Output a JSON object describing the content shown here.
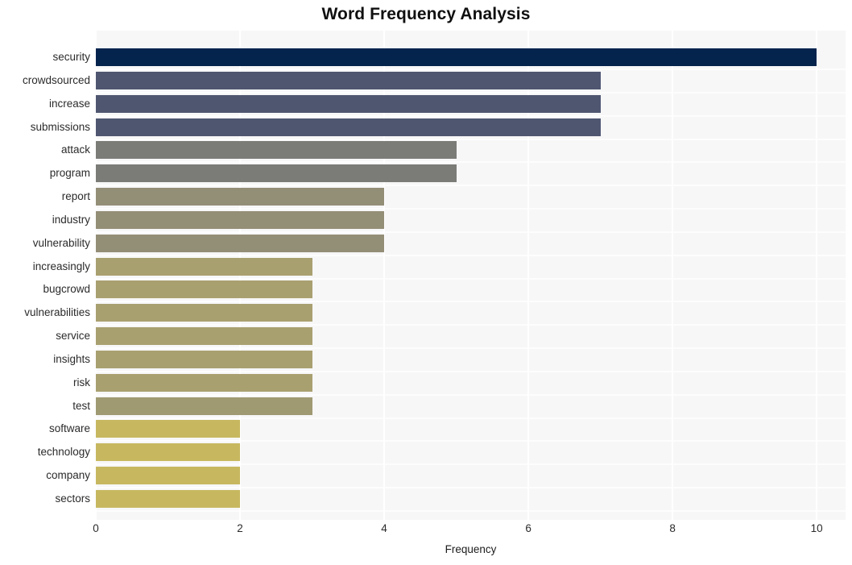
{
  "chart_data": {
    "type": "bar",
    "orientation": "horizontal",
    "title": "Word Frequency Analysis",
    "xlabel": "Frequency",
    "ylabel": "",
    "xlim": [
      0,
      10.4
    ],
    "xticks": [
      0,
      2,
      4,
      6,
      8,
      10
    ],
    "xtick_labels": [
      "0",
      "2",
      "4",
      "6",
      "8",
      "10"
    ],
    "grid": true,
    "legend": "none",
    "plot_background": "#f7f7f8",
    "figure_background": "#ffffff",
    "categories": [
      "security",
      "crowdsourced",
      "increase",
      "submissions",
      "attack",
      "program",
      "report",
      "industry",
      "vulnerability",
      "increasingly",
      "bugcrowd",
      "vulnerabilities",
      "service",
      "insights",
      "risk",
      "test",
      "software",
      "technology",
      "company",
      "sectors"
    ],
    "values": [
      10,
      7,
      7,
      7,
      5,
      5,
      4,
      4,
      4,
      3,
      3,
      3,
      3,
      3,
      3,
      3,
      2,
      2,
      2,
      2
    ],
    "bar_colors": [
      "#04234d",
      "#4e5670",
      "#4e5670",
      "#4e5670",
      "#7b7b78",
      "#7b7b78",
      "#938e76",
      "#938e76",
      "#938e76",
      "#a9a070",
      "#a9a070",
      "#a9a070",
      "#a9a070",
      "#a9a070",
      "#a9a070",
      "#a09a73",
      "#c7b860",
      "#c7b860",
      "#c7b860",
      "#c7b860"
    ]
  }
}
